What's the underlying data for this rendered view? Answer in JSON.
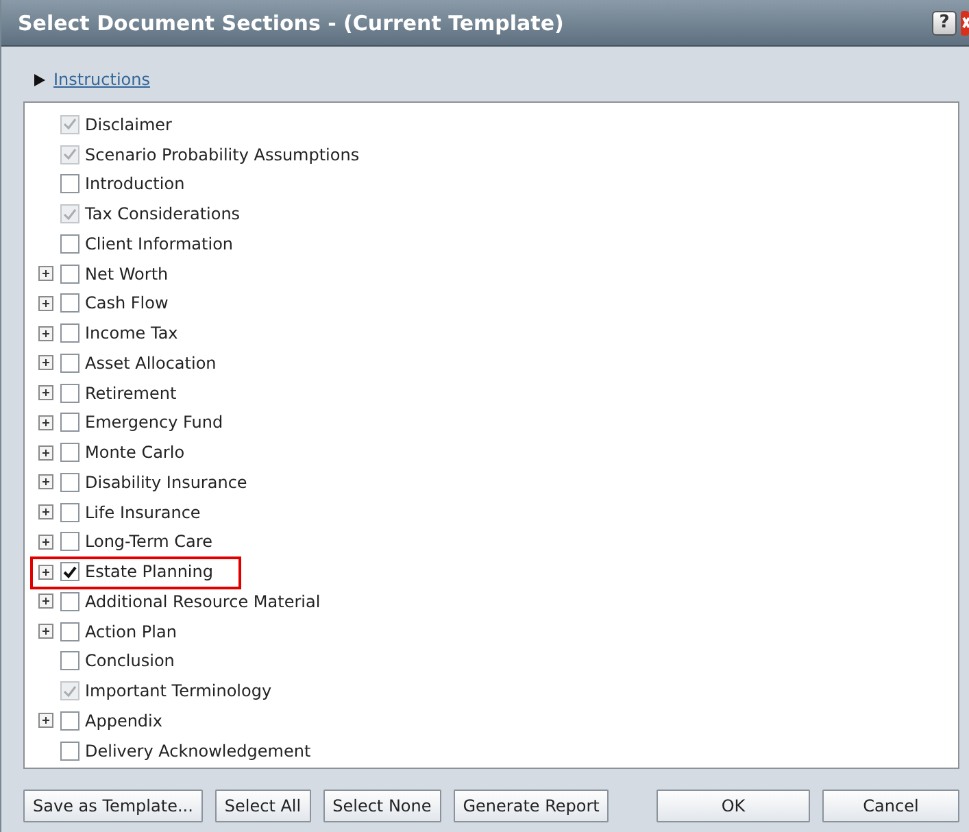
{
  "window": {
    "title": "Select Document Sections - (Current Template)",
    "help": "?"
  },
  "instructions": {
    "label": "Instructions",
    "expanded": false
  },
  "sections": [
    {
      "label": "Disclaimer",
      "checked": true,
      "disabled": true,
      "expandable": false,
      "highlighted": false
    },
    {
      "label": "Scenario Probability Assumptions",
      "checked": true,
      "disabled": true,
      "expandable": false,
      "highlighted": false
    },
    {
      "label": "Introduction",
      "checked": false,
      "disabled": false,
      "expandable": false,
      "highlighted": false
    },
    {
      "label": "Tax Considerations",
      "checked": true,
      "disabled": true,
      "expandable": false,
      "highlighted": false
    },
    {
      "label": "Client Information",
      "checked": false,
      "disabled": false,
      "expandable": false,
      "highlighted": false
    },
    {
      "label": "Net Worth",
      "checked": false,
      "disabled": false,
      "expandable": true,
      "highlighted": false
    },
    {
      "label": "Cash Flow",
      "checked": false,
      "disabled": false,
      "expandable": true,
      "highlighted": false
    },
    {
      "label": "Income Tax",
      "checked": false,
      "disabled": false,
      "expandable": true,
      "highlighted": false
    },
    {
      "label": "Asset Allocation",
      "checked": false,
      "disabled": false,
      "expandable": true,
      "highlighted": false
    },
    {
      "label": "Retirement",
      "checked": false,
      "disabled": false,
      "expandable": true,
      "highlighted": false
    },
    {
      "label": "Emergency Fund",
      "checked": false,
      "disabled": false,
      "expandable": true,
      "highlighted": false
    },
    {
      "label": "Monte Carlo",
      "checked": false,
      "disabled": false,
      "expandable": true,
      "highlighted": false
    },
    {
      "label": "Disability Insurance",
      "checked": false,
      "disabled": false,
      "expandable": true,
      "highlighted": false
    },
    {
      "label": "Life Insurance",
      "checked": false,
      "disabled": false,
      "expandable": true,
      "highlighted": false
    },
    {
      "label": "Long-Term Care",
      "checked": false,
      "disabled": false,
      "expandable": true,
      "highlighted": false
    },
    {
      "label": "Estate Planning",
      "checked": true,
      "disabled": false,
      "expandable": true,
      "highlighted": true
    },
    {
      "label": "Additional Resource Material",
      "checked": false,
      "disabled": false,
      "expandable": true,
      "highlighted": false
    },
    {
      "label": "Action Plan",
      "checked": false,
      "disabled": false,
      "expandable": true,
      "highlighted": false
    },
    {
      "label": "Conclusion",
      "checked": false,
      "disabled": false,
      "expandable": false,
      "highlighted": false
    },
    {
      "label": "Important Terminology",
      "checked": true,
      "disabled": true,
      "expandable": false,
      "highlighted": false
    },
    {
      "label": "Appendix",
      "checked": false,
      "disabled": false,
      "expandable": true,
      "highlighted": false
    },
    {
      "label": "Delivery Acknowledgement",
      "checked": false,
      "disabled": false,
      "expandable": false,
      "highlighted": false
    }
  ],
  "buttons_left": [
    "Save as Template...",
    "Select All",
    "Select None",
    "Generate Report"
  ],
  "buttons_right": [
    "OK",
    "Cancel"
  ]
}
